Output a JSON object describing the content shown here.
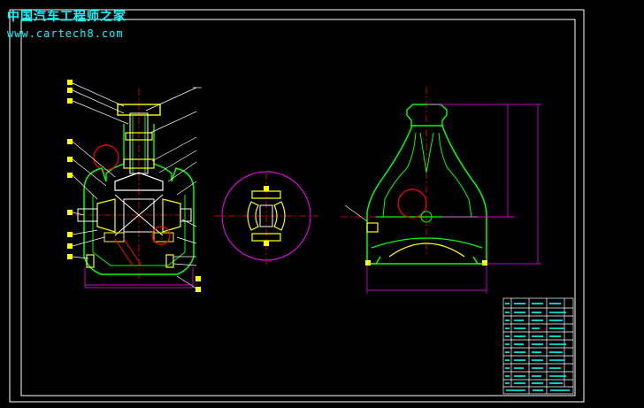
{
  "watermark": {
    "site_name": "中国汽车工程师之家",
    "url": "www.cartech8.com"
  },
  "colors": {
    "background": "#000000",
    "frame": "#ffffff",
    "body": "#00ff00",
    "centerline": "#ff0000",
    "dimension": "#ff00ff",
    "parts": "#ffff00",
    "leader": "#ffffff",
    "watermark": "#00ffff"
  },
  "icons": [
    "balloon-marker-icon",
    "part-number-tag-icon"
  ]
}
